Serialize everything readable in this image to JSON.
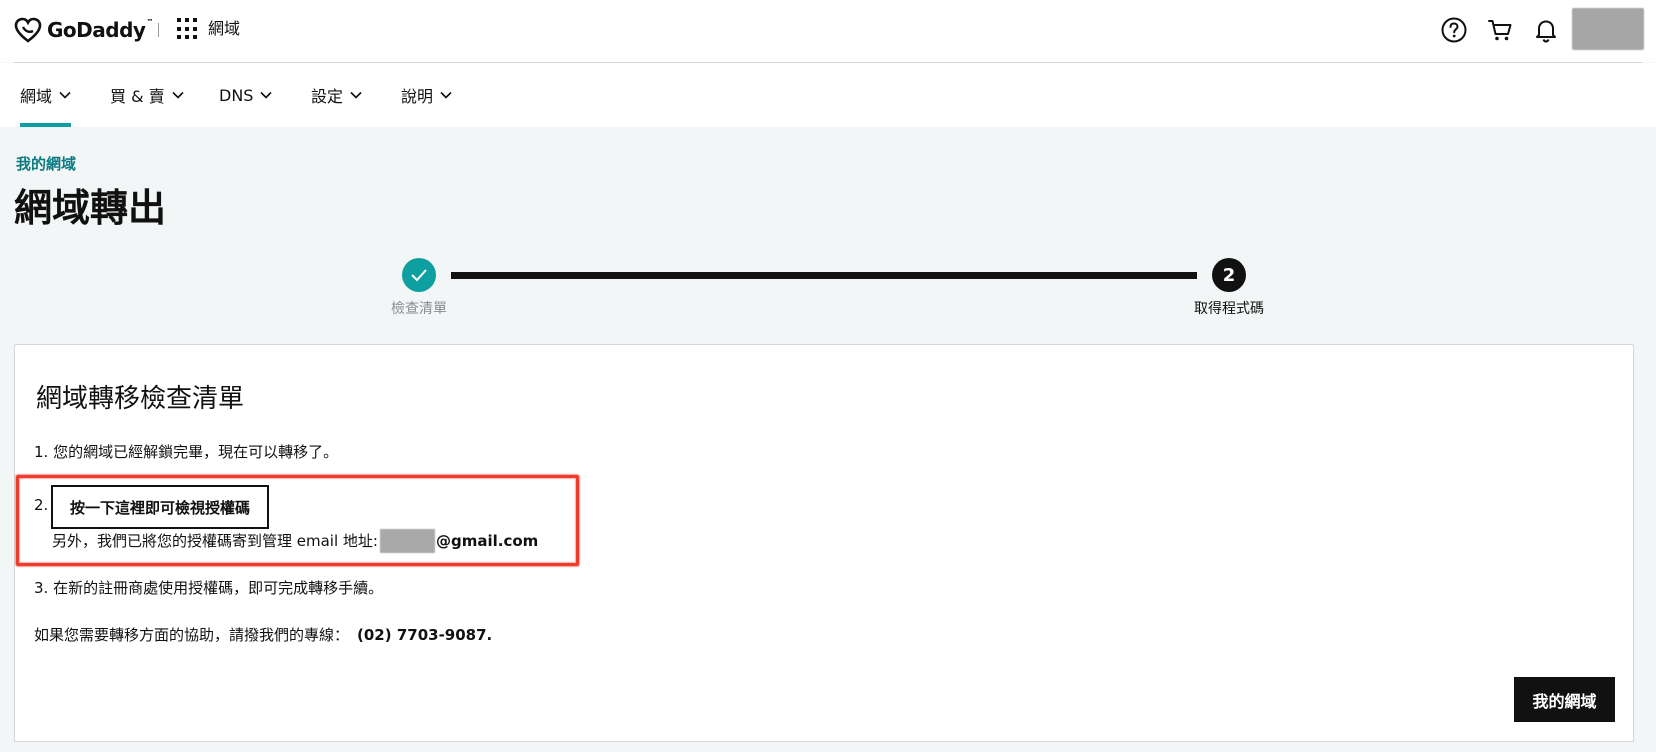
{
  "header": {
    "brand_name": "GoDaddy",
    "brand_tm": "™",
    "section_label": "網域",
    "icons": [
      "help-icon",
      "cart-icon",
      "bell-icon"
    ]
  },
  "nav": {
    "items": [
      {
        "label": "網域",
        "active": true
      },
      {
        "label": "買 & 賣",
        "active": false
      },
      {
        "label": "DNS",
        "active": false
      },
      {
        "label": "設定",
        "active": false
      },
      {
        "label": "說明",
        "active": false
      }
    ]
  },
  "page": {
    "breadcrumb": "我的網域",
    "title": "網域轉出"
  },
  "stepper": {
    "steps": [
      {
        "label": "檢查清單",
        "state": "complete"
      },
      {
        "label": "取得程式碼",
        "number": "2",
        "state": "current"
      }
    ]
  },
  "card": {
    "title": "網域轉移檢查清單",
    "item1": "1. 您的網域已經解鎖完畢，現在可以轉移了。",
    "item2_number": "2.",
    "auth_button_label": "按一下這裡即可檢視授權碼",
    "item2_note": "另外，我們已將您的授權碼寄到管理 email 地址:",
    "email_domain": "@gmail.com",
    "item3": "3. 在新的註冊商處使用授權碼，即可完成轉移手續。",
    "help_text": "如果您需要轉移方面的協助，請撥我們的專線：",
    "phone": "(02) 7703-9087.",
    "my_domains_button": "我的網域"
  },
  "colors": {
    "accent": "#0ea0a0",
    "breadcrumb": "#0d7c82",
    "highlight": "#ef3b2c"
  }
}
